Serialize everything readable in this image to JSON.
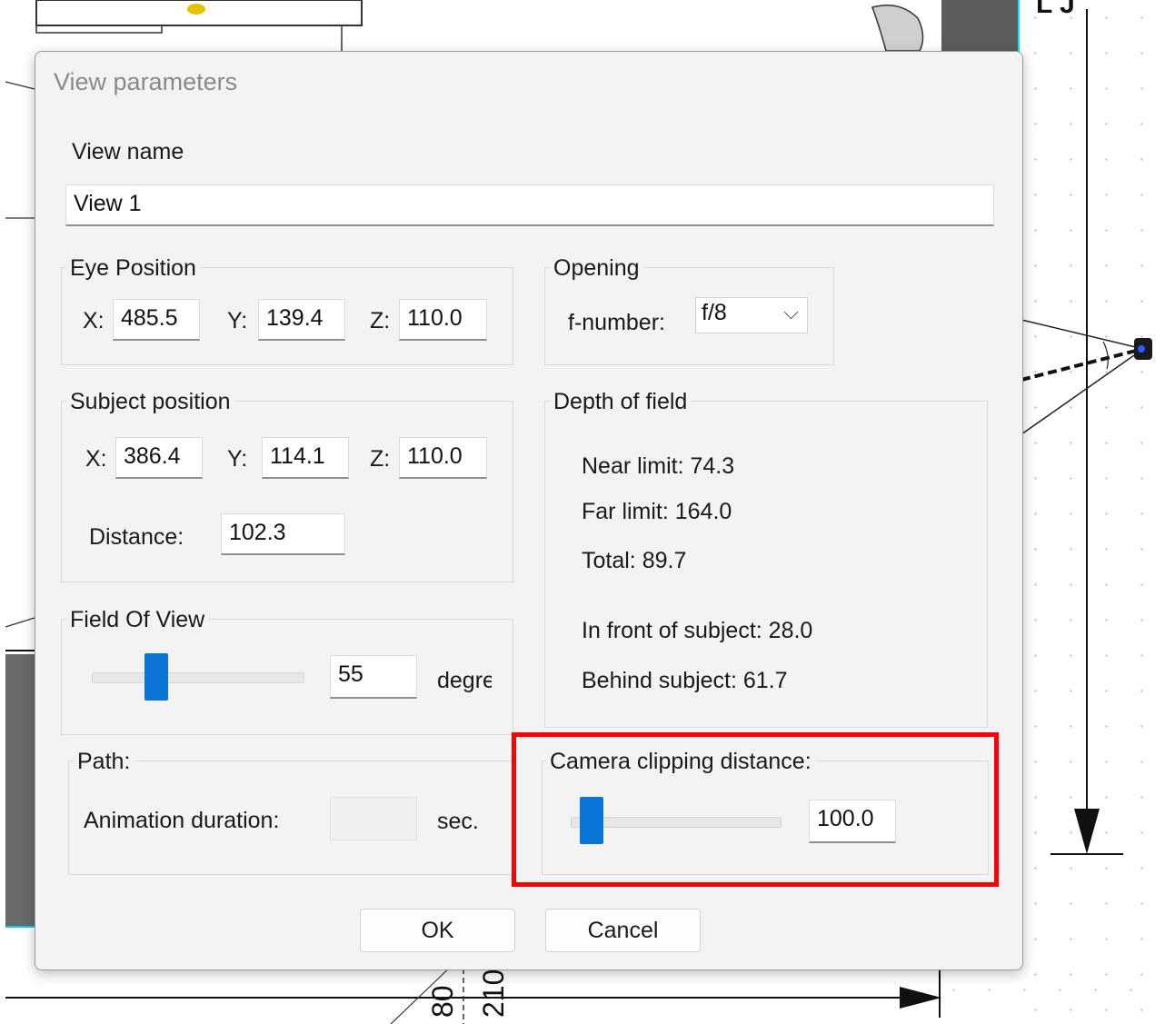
{
  "dialog": {
    "title": "View parameters",
    "view_name_label": "View name",
    "view_name_value": "View 1",
    "eye_position": {
      "title": "Eye Position",
      "x_label": "X:",
      "x_value": "485.5",
      "y_label": "Y:",
      "y_value": "139.4",
      "z_label": "Z:",
      "z_value": "110.0"
    },
    "opening": {
      "title": "Opening",
      "fnumber_label": "f-number:",
      "fnumber_value": "f/8"
    },
    "subject_position": {
      "title": "Subject position",
      "x_label": "X:",
      "x_value": "386.4",
      "y_label": "Y:",
      "y_value": "114.1",
      "z_label": "Z:",
      "z_value": "110.0",
      "distance_label": "Distance:",
      "distance_value": "102.3"
    },
    "depth_of_field": {
      "title": "Depth of field",
      "near": "Near limit: 74.3",
      "far": "Far limit: 164.0",
      "total": "Total: 89.7",
      "front": "In front of subject: 28.0",
      "behind": "Behind subject: 61.7"
    },
    "field_of_view": {
      "title": "Field Of View",
      "value": "55",
      "unit": "degre",
      "slider_fraction": 0.28
    },
    "path": {
      "title": "Path:",
      "animation_label": "Animation duration:",
      "animation_value": "",
      "unit": "sec."
    },
    "camera_clipping": {
      "title": "Camera clipping distance:",
      "value": "100.0",
      "slider_fraction": 0.05
    },
    "buttons": {
      "ok": "OK",
      "cancel": "Cancel"
    }
  },
  "background": {
    "bottom_labels": [
      "80",
      "210"
    ]
  },
  "colors": {
    "accent": "#0a74d8",
    "highlight": "#ff0000",
    "dialog_bg": "#f3f3f3"
  }
}
